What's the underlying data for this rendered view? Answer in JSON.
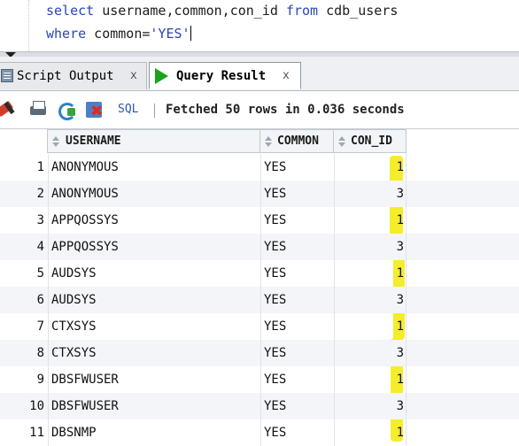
{
  "editor": {
    "line1": {
      "kw1": "select",
      "cols": " username,common,con_id ",
      "kw2": "from",
      "table": " cdb_users"
    },
    "line2": {
      "kw1": "where",
      "cond": " common=",
      "str": "'YES'"
    }
  },
  "tabs": [
    {
      "label": "Script Output",
      "close": "x",
      "icon": "script-icon",
      "active": false
    },
    {
      "label": "Query Result",
      "close": "x",
      "icon": "run-icon",
      "active": true
    }
  ],
  "toolbar": {
    "sql_label": "SQL",
    "status": "Fetched 50 rows in 0.036 seconds",
    "icons": [
      "pin-icon",
      "print-icon",
      "refresh-icon",
      "cancel-icon"
    ]
  },
  "grid": {
    "columns": [
      "USERNAME",
      "COMMON",
      "CON_ID"
    ],
    "rows": [
      {
        "n": "1",
        "username": "ANONYMOUS",
        "common": "YES",
        "con_id": "1"
      },
      {
        "n": "2",
        "username": "ANONYMOUS",
        "common": "YES",
        "con_id": "3"
      },
      {
        "n": "3",
        "username": "APPQOSSYS",
        "common": "YES",
        "con_id": "1"
      },
      {
        "n": "4",
        "username": "APPQOSSYS",
        "common": "YES",
        "con_id": "3"
      },
      {
        "n": "5",
        "username": "AUDSYS",
        "common": "YES",
        "con_id": "1"
      },
      {
        "n": "6",
        "username": "AUDSYS",
        "common": "YES",
        "con_id": "3"
      },
      {
        "n": "7",
        "username": "CTXSYS",
        "common": "YES",
        "con_id": "1"
      },
      {
        "n": "8",
        "username": "CTXSYS",
        "common": "YES",
        "con_id": "3"
      },
      {
        "n": "9",
        "username": "DBSFWUSER",
        "common": "YES",
        "con_id": "1"
      },
      {
        "n": "10",
        "username": "DBSFWUSER",
        "common": "YES",
        "con_id": "3"
      },
      {
        "n": "11",
        "username": "DBSNMP",
        "common": "YES",
        "con_id": "1"
      }
    ]
  },
  "colors": {
    "keyword": "#2a46b5",
    "highlighter": "#f4ec1f",
    "run_icon": "#1aa31a"
  }
}
